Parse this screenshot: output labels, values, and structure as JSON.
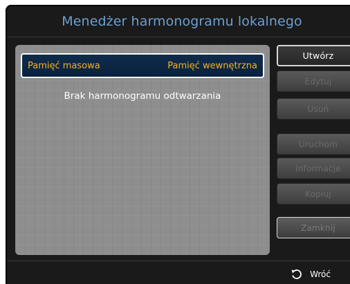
{
  "title": "Menedżer harmonogramu lokalnego",
  "storage": {
    "label": "Pamięć masowa",
    "value": "Pamięć wewnętrzna"
  },
  "empty_message": "Brak harmonogramu odtwarzania",
  "buttons": {
    "create": "Utwórz",
    "edit": "Edytuj",
    "delete": "Usuń",
    "run": "Uruchom",
    "info": "Informacje",
    "copy": "Kopiuj",
    "close": "Zamknij"
  },
  "footer": {
    "back_icon": "return-arrow-icon",
    "back_label": "Wróć"
  },
  "colors": {
    "title": "#6d9fd2",
    "storage_text": "#f3b324",
    "panel": "#8e8e8e",
    "screen": "#1a1a1a"
  }
}
